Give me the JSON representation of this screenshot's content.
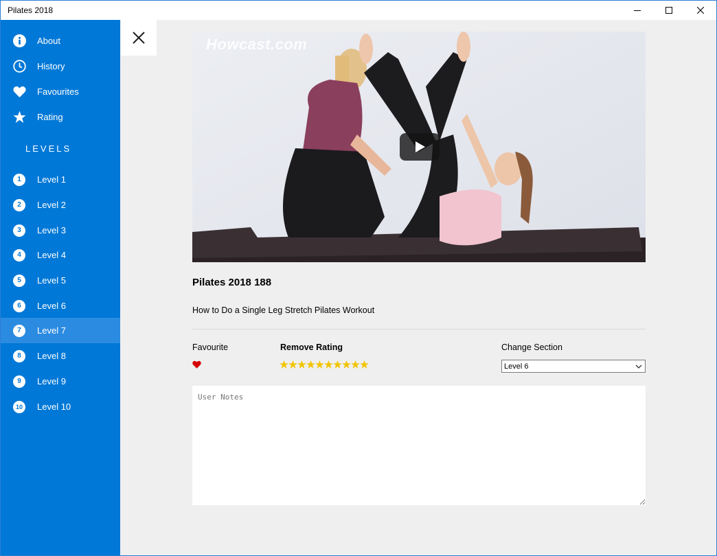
{
  "window": {
    "title": "Pilates 2018"
  },
  "sidebar": {
    "top_items": [
      {
        "label": "About",
        "icon": "info-icon"
      },
      {
        "label": "History",
        "icon": "clock-icon"
      },
      {
        "label": "Favourites",
        "icon": "heart-icon"
      },
      {
        "label": "Rating",
        "icon": "star-icon"
      }
    ],
    "section_header": "LEVELS",
    "levels": [
      {
        "num": "1",
        "label": "Level 1"
      },
      {
        "num": "2",
        "label": "Level 2"
      },
      {
        "num": "3",
        "label": "Level 3"
      },
      {
        "num": "4",
        "label": "Level 4"
      },
      {
        "num": "5",
        "label": "Level 5"
      },
      {
        "num": "6",
        "label": "Level 6"
      },
      {
        "num": "7",
        "label": "Level 7"
      },
      {
        "num": "8",
        "label": "Level 8"
      },
      {
        "num": "9",
        "label": "Level 9"
      },
      {
        "num": "10",
        "label": "Level 10"
      }
    ],
    "selected_level": "Level 7"
  },
  "video": {
    "watermark": "Howcast.com"
  },
  "content": {
    "title": "Pilates 2018 188",
    "description": "How to Do a Single Leg Stretch Pilates Workout",
    "favourite_label": "Favourite",
    "rating_label": "Remove Rating",
    "rating_value": 10,
    "rating_max": 10,
    "section_label": "Change Section",
    "section_selected": "Level 6",
    "notes_placeholder": "User Notes"
  },
  "colors": {
    "sidebar_bg": "#0078d7",
    "selected_bg": "#2b8be0",
    "heart": "#d40000",
    "star": "#f2c500"
  }
}
